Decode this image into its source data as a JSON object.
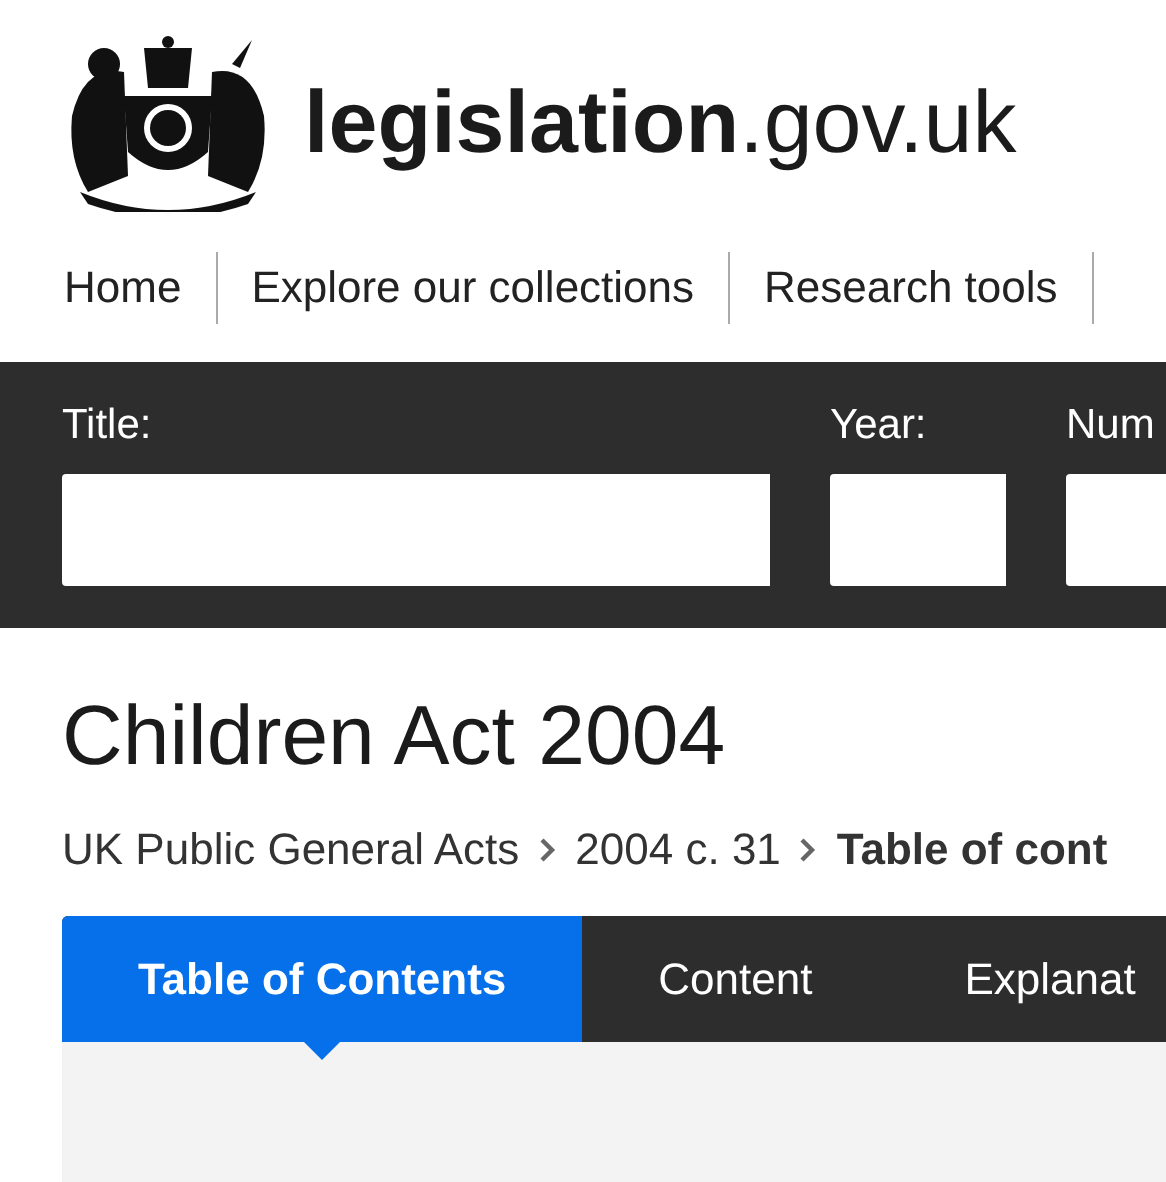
{
  "header": {
    "logo_bold": "legislation",
    "logo_rest": ".gov.uk"
  },
  "nav": [
    {
      "label": "Home"
    },
    {
      "label": "Explore our collections"
    },
    {
      "label": "Research tools"
    }
  ],
  "search": {
    "fields": [
      {
        "label": "Title:"
      },
      {
        "label": "Year:"
      },
      {
        "label": "Num"
      }
    ]
  },
  "page_title": "Children Act 2004",
  "breadcrumb": [
    {
      "label": "UK Public General Acts",
      "current": false
    },
    {
      "label": "2004 c. 31",
      "current": false
    },
    {
      "label": "Table of cont",
      "current": true
    }
  ],
  "tabs": [
    {
      "label": "Table of Contents",
      "selected": true
    },
    {
      "label": "Content",
      "selected": false
    },
    {
      "label": "Explanat",
      "selected": false
    }
  ]
}
